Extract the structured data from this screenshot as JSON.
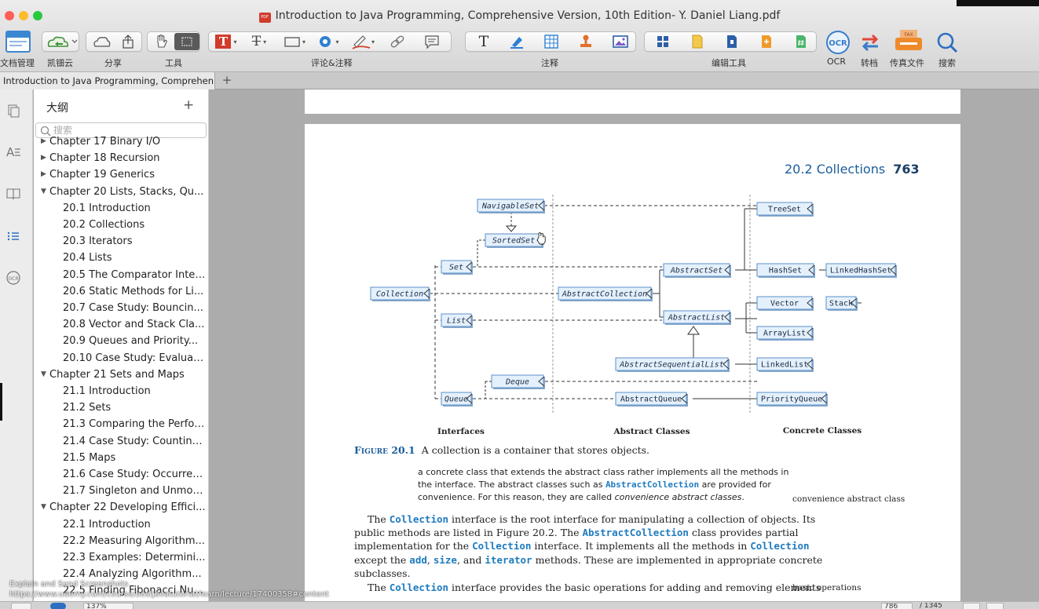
{
  "window": {
    "title": "Introduction to Java Programming, Comprehensive Version, 10th Edition- Y. Daniel Liang.pdf",
    "pdf_badge": "PDF"
  },
  "toolbar": {
    "labels": {
      "file_manage": "文档管理",
      "cloud": "凯钿云",
      "share": "分享",
      "tools": "工具",
      "comment": "评论&注释",
      "annotate": "注释",
      "edit_tools": "编辑工具",
      "ocr": "OCR",
      "convert": "转档",
      "fax": "传真文件",
      "search": "搜索"
    },
    "ocr_glyph": "OCR",
    "fax_glyph": "FAX",
    "text_glyph": "T",
    "strike_glyph": "T"
  },
  "colors": {
    "accent_blue": "#1b5d9c",
    "code_blue": "#1e7bbf",
    "node_fill": "#e4f0fb",
    "node_border": "#5b8fc9",
    "red": "#d23b2b"
  },
  "tab": {
    "label": "Introduction to Java Programming, Comprehen...",
    "add": "+"
  },
  "sidebar": {
    "title": "大纲",
    "add": "+",
    "search_placeholder": "搜索",
    "items": [
      {
        "label": "Chapter 17 Binary I/O",
        "level": 0,
        "state": "collapsed"
      },
      {
        "label": "Chapter 18 Recursion",
        "level": 0,
        "state": "collapsed"
      },
      {
        "label": "Chapter 19 Generics",
        "level": 0,
        "state": "collapsed"
      },
      {
        "label": "Chapter 20 Lists, Stacks, Qu...",
        "level": 0,
        "state": "expanded"
      },
      {
        "label": "20.1 Introduction",
        "level": 1
      },
      {
        "label": "20.2 Collections",
        "level": 1
      },
      {
        "label": "20.3 Iterators",
        "level": 1
      },
      {
        "label": "20.4 Lists",
        "level": 1
      },
      {
        "label": "20.5 The Comparator Inter...",
        "level": 1
      },
      {
        "label": "20.6 Static Methods for Li...",
        "level": 1
      },
      {
        "label": "20.7 Case Study: Bouncin...",
        "level": 1
      },
      {
        "label": "20.8 Vector and Stack Cla...",
        "level": 1
      },
      {
        "label": "20.9 Queues and Priority...",
        "level": 1
      },
      {
        "label": "20.10 Case Study: Evaluati...",
        "level": 1
      },
      {
        "label": "Chapter 21 Sets and Maps",
        "level": 0,
        "state": "expanded"
      },
      {
        "label": "21.1 Introduction",
        "level": 1
      },
      {
        "label": "21.2 Sets",
        "level": 1
      },
      {
        "label": "21.3 Comparing the Perfor...",
        "level": 1
      },
      {
        "label": "21.4 Case Study: Counting...",
        "level": 1
      },
      {
        "label": "21.5 Maps",
        "level": 1
      },
      {
        "label": "21.6 Case Study: Occurren...",
        "level": 1
      },
      {
        "label": "21.7 Singleton and Unmod...",
        "level": 1
      },
      {
        "label": "Chapter 22 Developing Effici...",
        "level": 0,
        "state": "expanded"
      },
      {
        "label": "22.1 Introduction",
        "level": 1
      },
      {
        "label": "22.2 Measuring Algorithm...",
        "level": 1
      },
      {
        "label": "22.3 Examples: Determini...",
        "level": 1
      },
      {
        "label": "22.4 Analyzing Algorithm...",
        "level": 1
      },
      {
        "label": "22.5 Finding Fibonacci Nu...",
        "level": 1
      }
    ]
  },
  "page": {
    "running_head": {
      "section": "20.2  Collections",
      "number": "763"
    },
    "diagram": {
      "nodes": {
        "NavigableSet": "NavigableSet",
        "SortedSet": "SortedSet",
        "Set": "Set",
        "Collection": "Collection",
        "List": "List",
        "Deque": "Deque",
        "Queue": "Queue",
        "AbstractSet": "AbstractSet",
        "AbstractCollection": "AbstractCollection",
        "AbstractList": "AbstractList",
        "AbstractSequentialList": "AbstractSequentialList",
        "AbstractQueue": "AbstractQueue",
        "TreeSet": "TreeSet",
        "HashSet": "HashSet",
        "LinkedHashSet": "LinkedHashSet",
        "Vector": "Vector",
        "Stack": "Stack",
        "ArrayList": "ArrayList",
        "LinkedList": "LinkedList",
        "PriorityQueue": "PriorityQueue"
      },
      "columns": {
        "interfaces": "Interfaces",
        "abstract": "Abstract Classes",
        "concrete": "Concrete Classes"
      }
    },
    "figure": {
      "label": "Figure 20.1",
      "caption": "A collection is a container that stores objects."
    },
    "para1": {
      "l1": "a concrete class that extends the abstract class rather implements all the methods in",
      "l2a": "the interface. The abstract classes such as ",
      "l2code": "AbstractCollection",
      "l2b": " are provided for",
      "l3a": "convenience. For this reason, they are called ",
      "l3em": "convenience abstract classes",
      "l3b": "."
    },
    "margin1": "convenience abstract class",
    "para2": {
      "l1a": "The ",
      "l1code": "Collection",
      "l1b": " interface is the root interface for manipulating a collection of objects. Its",
      "l2a": "public methods are listed in Figure 20.2. The ",
      "l2code": "AbstractCollection",
      "l2b": " class provides partial",
      "l3a": "implementation for the ",
      "l3code": "Collection",
      "l3b": " interface. It implements all the methods in ",
      "l3code2": "Collection",
      "l4a": "except the ",
      "l4c1": "add",
      "l4s1": ",  ",
      "l4c2": "size",
      "l4s2": ", and ",
      "l4c3": "iterator",
      "l4b": " methods. These are implemented in appropriate concrete",
      "l5": "subclasses."
    },
    "para3": {
      "l1a": "The ",
      "l1code": "Collection",
      "l1b": " interface provides the basic operations for adding and removing elements"
    },
    "margin2": "basic operations"
  },
  "overlay": {
    "line1": "Explain and Send Screenshots",
    "line2": "https://www.udemy.com/course/bestjavatutorial/learn/lecture/17400358#content"
  },
  "status": {
    "zoom": "137%",
    "page_current": "786",
    "page_total": "/ 1345"
  }
}
